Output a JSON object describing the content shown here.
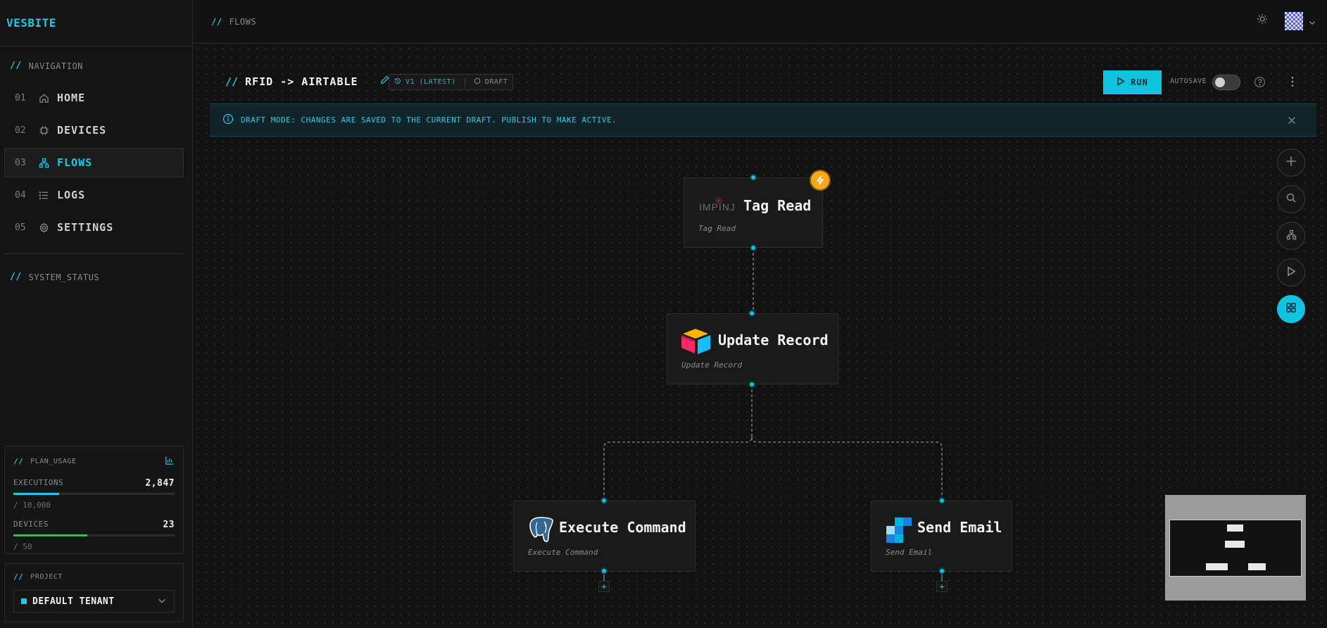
{
  "sidebar": {
    "brand": "VESBITE",
    "nav_heading": "NAVIGATION",
    "items": [
      {
        "num": "01",
        "label": "HOME",
        "icon": "home-icon"
      },
      {
        "num": "02",
        "label": "DEVICES",
        "icon": "chip-icon"
      },
      {
        "num": "03",
        "label": "FLOWS",
        "icon": "flows-icon",
        "active": true
      },
      {
        "num": "04",
        "label": "LOGS",
        "icon": "list-icon"
      },
      {
        "num": "05",
        "label": "SETTINGS",
        "icon": "gear-icon"
      }
    ],
    "status_heading": "SYSTEM_STATUS",
    "plan_usage": {
      "heading": "PLAN_USAGE",
      "executions": {
        "label": "EXECUTIONS",
        "value": "2,847",
        "limit": "/ 10,000",
        "fraction": 0.2847,
        "color": "#1fc8e3"
      },
      "devices": {
        "label": "DEVICES",
        "value": "23",
        "limit": "/ 50",
        "fraction": 0.46,
        "color": "#22c55e"
      }
    },
    "project": {
      "heading": "PROJECT",
      "selected": "DEFAULT TENANT"
    }
  },
  "topbar": {
    "breadcrumb": "FLOWS"
  },
  "editor": {
    "flow_name": "RFID -> AIRTABLE",
    "version": "V1 (LATEST)",
    "status": "DRAFT",
    "run_label": "RUN",
    "autosave_label": "AUTOSAVE",
    "autosave_on": false,
    "banner": "DRAFT MODE: CHANGES ARE SAVED TO THE CURRENT DRAFT. PUBLISH TO MAKE ACTIVE."
  },
  "nodes": [
    {
      "id": "tag-read",
      "title": "Tag Read",
      "subtitle": "Tag Read",
      "logo": "IMPINJ",
      "trigger": true
    },
    {
      "id": "update-record",
      "title": "Update Record",
      "subtitle": "Update Record",
      "logo": "airtable-icon"
    },
    {
      "id": "execute-command",
      "title": "Execute Command",
      "subtitle": "Execute Command",
      "logo": "postgres-icon"
    },
    {
      "id": "send-email",
      "title": "Send Email",
      "subtitle": "Send Email",
      "logo": "sendgrid-icon"
    }
  ],
  "colors": {
    "accent": "#1fc8e3",
    "trigger": "#f5a81c",
    "success": "#22c55e"
  }
}
